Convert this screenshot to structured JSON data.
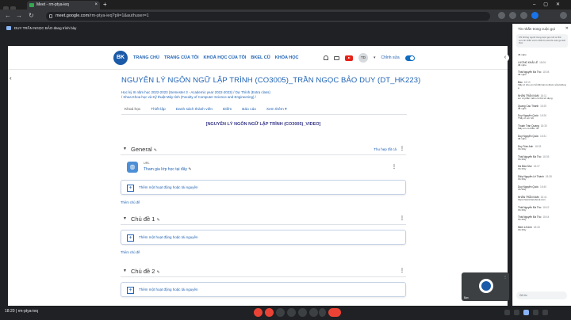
{
  "browser": {
    "tab_title": "Meet - rm-ptya-ieq",
    "tab_close": "×",
    "new_tab": "+",
    "window_buttons": "–▢✕",
    "url_host": "meet.google.com",
    "url_path": "/rm-ptya-ieq?pli=1&authuser=1",
    "back": "←",
    "forward": "→",
    "reload": "↻"
  },
  "presentation_bar": {
    "label": "DUY TRẦN NGỌC BẢO đang trình bày"
  },
  "site": {
    "logo_text": "BK",
    "menu": [
      "TRANG CHỦ",
      "TRANG CỦA TÔI",
      "KHOÁ HỌC CỦA TÔI",
      "BKEL CŨ",
      "KHÓA HỌC"
    ],
    "avatar_initials": "TD",
    "edit_mode_label": "Chỉnh sửa"
  },
  "course": {
    "title": "NGUYÊN LÝ NGÔN NGỮ LẬP TRÌNH (CO3005)_TRẦN NGỌC BẢO DUY (DT_HK223)",
    "breadcrumb1": "Học kỳ III năm học 2022-2023 (Semester 3 - Academic year 2022-2023)  /  Dự Thính (Extra class)",
    "breadcrumb2": "/  Khoa Khoa học và Kỹ thuật Máy tính (Faculty of Computer Science and Engineering)  /",
    "tabs": [
      "Khoá học",
      "Thiết lập",
      "Danh sách thành viên",
      "Điểm",
      "Báo cáo",
      "Xem thêm ▾"
    ],
    "banner": "[NGUYÊN LÝ NGÔN NGỮ LẬP TRÌNH (CO3005)_VIDEO]",
    "collapse_all": "Thu hẹp tất cả",
    "sections": [
      {
        "title": "General",
        "add_activity": "Thêm một hoạt động hoặc tài nguyên",
        "add_section": "Thêm chủ đề"
      },
      {
        "title": "Chủ đề 1",
        "add_activity": "Thêm một hoạt động hoặc tài nguyên",
        "add_section": "Thêm chủ đề"
      },
      {
        "title": "Chủ đề 2",
        "add_activity": "Thêm một hoạt động hoặc tài nguyên"
      }
    ],
    "url_activity": {
      "type": "URL",
      "name": "Tham gia lớp học tại đây"
    }
  },
  "chat": {
    "title": "Tin nhắn trong cuộc gọi",
    "close": "✕",
    "note": "Chỉ những người trong cuộc gọi mới có thể xem tin nhắn và tin nhắn bị xoá khi cuộc gọi kết thúc",
    "messages": [
      {
        "who": "",
        "time": "",
        "text": "đã nghe"
      },
      {
        "who": "LƯƠNG KHẢI LÊ",
        "time": "18:06",
        "text": "đã nghe"
      },
      {
        "who": "Thái Nguyễn Đà Tho",
        "time": "18:08",
        "text": "đã nghe"
      },
      {
        "who": "Bảo",
        "time": "18:10",
        "text": "thầy ơi cho em hỏi đề bài có được sửa không ạ"
      },
      {
        "who": "NHÂN TRẦN NAM",
        "time": "18:11",
        "text": "em ơi phần mềm có thể sử dụng"
      },
      {
        "who": "Quang Cao Thành",
        "time": "18:20",
        "text": "đã nghe"
      },
      {
        "who": "Duy Nguyễn Quốc",
        "time": "18:26",
        "text": "Thầy ơi em hỏi"
      },
      {
        "who": "Thuận Trần Quang",
        "time": "18:30",
        "text": "Mấy em có điểm rồi"
      },
      {
        "who": "Duy Nguyễn Quốc",
        "time": "18:31",
        "text": "đã nghe"
      },
      {
        "who": "Duy Trần Anh",
        "time": "18:33",
        "text": "Ok thầy"
      },
      {
        "who": "Thái Nguyễn Đà Tho",
        "time": "18:35",
        "text": "Ok thầy"
      },
      {
        "who": "Hà Bảo Như",
        "time": "18:37",
        "text": "Ok thầy"
      },
      {
        "who": "Diệp Nguyễn Lê Thành",
        "time": "18:38",
        "text": "Ok thầy"
      },
      {
        "who": "Duy Nguyễn Quốc",
        "time": "18:40",
        "text": "Ok thầy"
      },
      {
        "who": "NHÂN TRẦN NAM",
        "time": "18:41",
        "text": "https://www.facebook.com"
      },
      {
        "who": "Thái Nguyễn Đà Tho",
        "time": "18:42",
        "text": "Ok thầy"
      },
      {
        "who": "Thái Nguyễn Đà Tho",
        "time": "18:44",
        "text": "Ok thầy"
      },
      {
        "who": "Minh Lê Anh",
        "time": "18:45",
        "text": "Ok thầy"
      }
    ],
    "input_placeholder": "Gửi tin"
  },
  "self_view": {
    "name": "Bạn",
    "mic": "⋮"
  },
  "meeting_bar": {
    "time": "18:20",
    "code": "rm-ptya-ieq"
  }
}
